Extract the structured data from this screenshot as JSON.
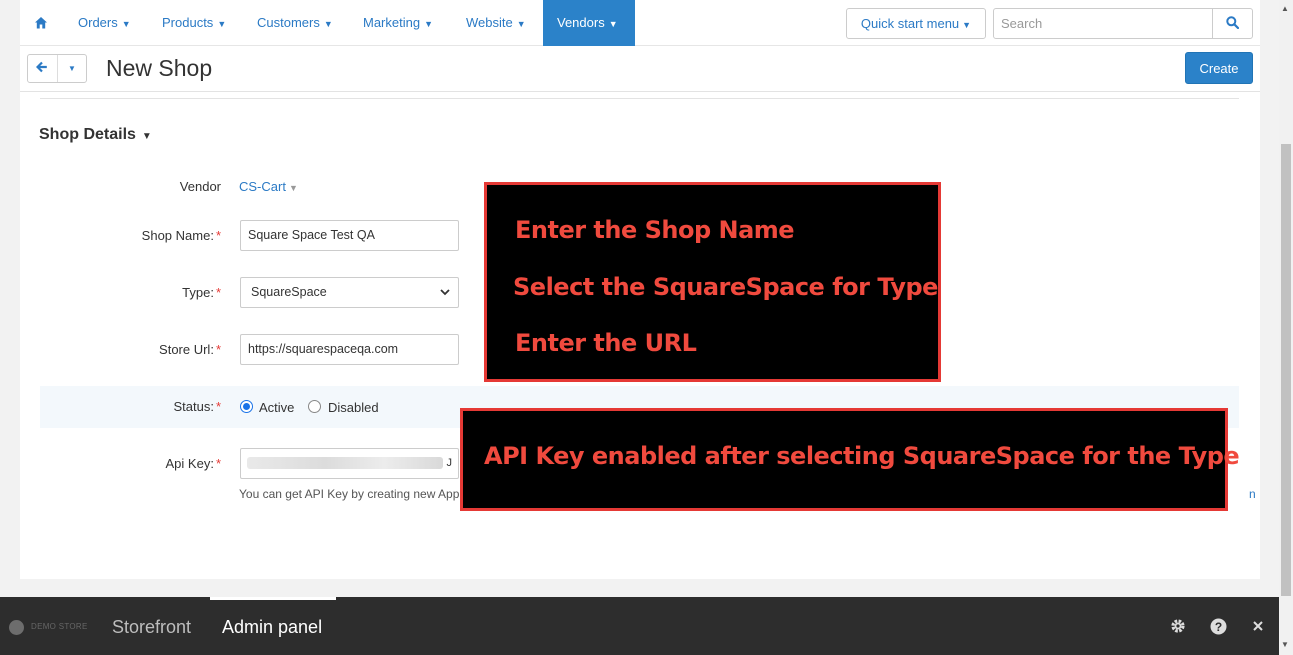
{
  "nav": {
    "home_icon": "home-icon",
    "items": [
      {
        "label": "Orders"
      },
      {
        "label": "Products"
      },
      {
        "label": "Customers"
      },
      {
        "label": "Marketing"
      },
      {
        "label": "Website"
      },
      {
        "label": "Vendors",
        "active": true
      }
    ],
    "quick_start": "Quick start menu",
    "search_placeholder": "Search",
    "search_icon": "search-icon"
  },
  "titlebar": {
    "title": "New Shop",
    "create_label": "Create"
  },
  "section": {
    "title": "Shop Details"
  },
  "form": {
    "vendor_label": "Vendor",
    "vendor_value": "CS-Cart",
    "shop_name_label": "Shop Name:",
    "shop_name_value": "Square Space Test QA",
    "type_label": "Type:",
    "type_value": "SquareSpace",
    "store_url_label": "Store Url:",
    "store_url_value": "https://squarespaceqa.com",
    "status_label": "Status:",
    "status_active": "Active",
    "status_disabled": "Disabled",
    "status_selected": "Active",
    "api_key_label": "Api Key:",
    "api_key_value_tail": "J",
    "api_help": "You can get API Key by creating new App",
    "api_help_tail": "n",
    "required_mark": "*"
  },
  "annotations": {
    "box1": [
      "Enter the Shop Name",
      "Select the SquareSpace for Type",
      "Enter the URL"
    ],
    "box2": "API Key enabled after selecting SquareSpace for the Type"
  },
  "bottom": {
    "demo_label": "DEMO STORE",
    "storefront": "Storefront",
    "admin_panel": "Admin panel"
  },
  "colors": {
    "accent": "#2b82c9",
    "link": "#2b7ac5",
    "annotation_border": "#e53935",
    "annotation_text": "#f04a3e"
  }
}
